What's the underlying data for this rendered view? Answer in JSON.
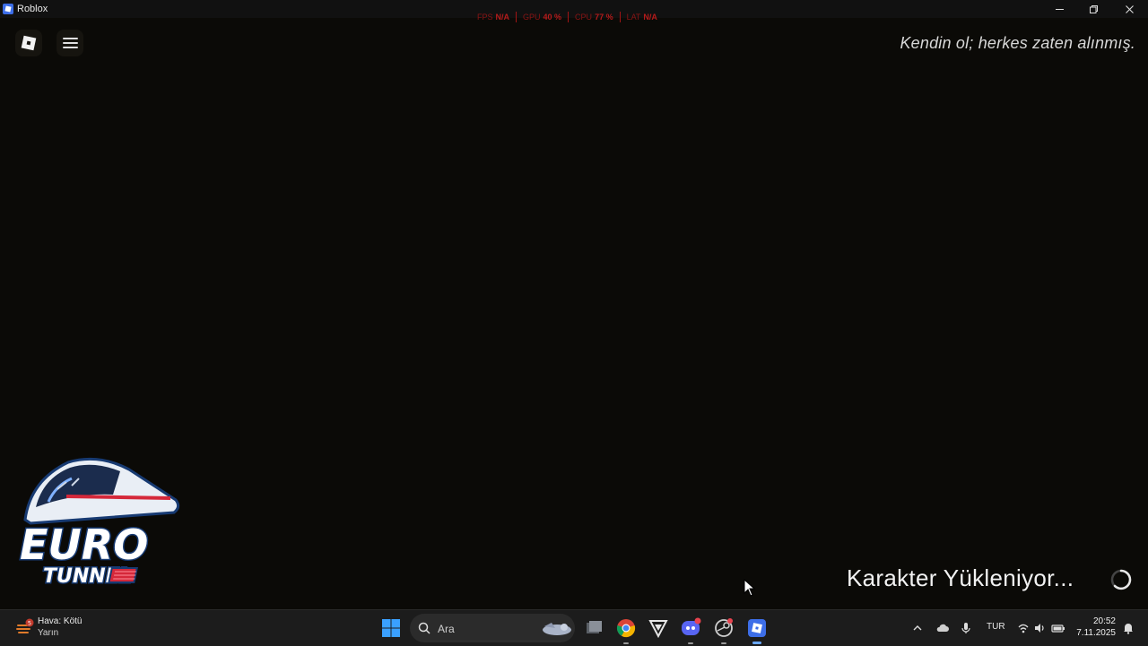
{
  "window": {
    "title": "Roblox",
    "controls": [
      "minimize-icon",
      "restore-icon",
      "close-icon"
    ]
  },
  "perf_overlay": {
    "items": [
      {
        "label": "FPS",
        "value": "N/A"
      },
      {
        "label": "GPU",
        "value": "40 %"
      },
      {
        "label": "CPU",
        "value": "77 %"
      },
      {
        "label": "LAT",
        "value": "N/A"
      }
    ],
    "color": "#b51b1b"
  },
  "game": {
    "tagline": "Kendin ol; herkes zaten alınmış.",
    "loading_text": "Karakter Yükleniyor...",
    "brand": {
      "line1": "EURO",
      "line2": "TUNNEL"
    },
    "icons": [
      "roblox-logo-icon",
      "hamburger-menu-icon",
      "loading-spinner-icon"
    ]
  },
  "taskbar": {
    "weather": {
      "line1": "Hava: Kötü",
      "line2": "Yarın",
      "badge": "5"
    },
    "search_placeholder": "Ara",
    "apps": [
      "windows-start-icon",
      "task-view-icon",
      "chrome-icon",
      "vivaldi-icon",
      "discord-icon",
      "steam-icon",
      "roblox-icon"
    ],
    "tray": {
      "language": "TUR",
      "icons": [
        "chevron-up-icon",
        "cloud-icon",
        "microphone-icon",
        "wifi-icon",
        "speaker-icon",
        "battery-icon",
        "notification-icon"
      ]
    },
    "time": "20:52",
    "date": "7.11.2025"
  },
  "colors": {
    "accent": "#6aa8ff",
    "brand_blue": "#1f5fd6",
    "brand_red": "#d5283a"
  }
}
